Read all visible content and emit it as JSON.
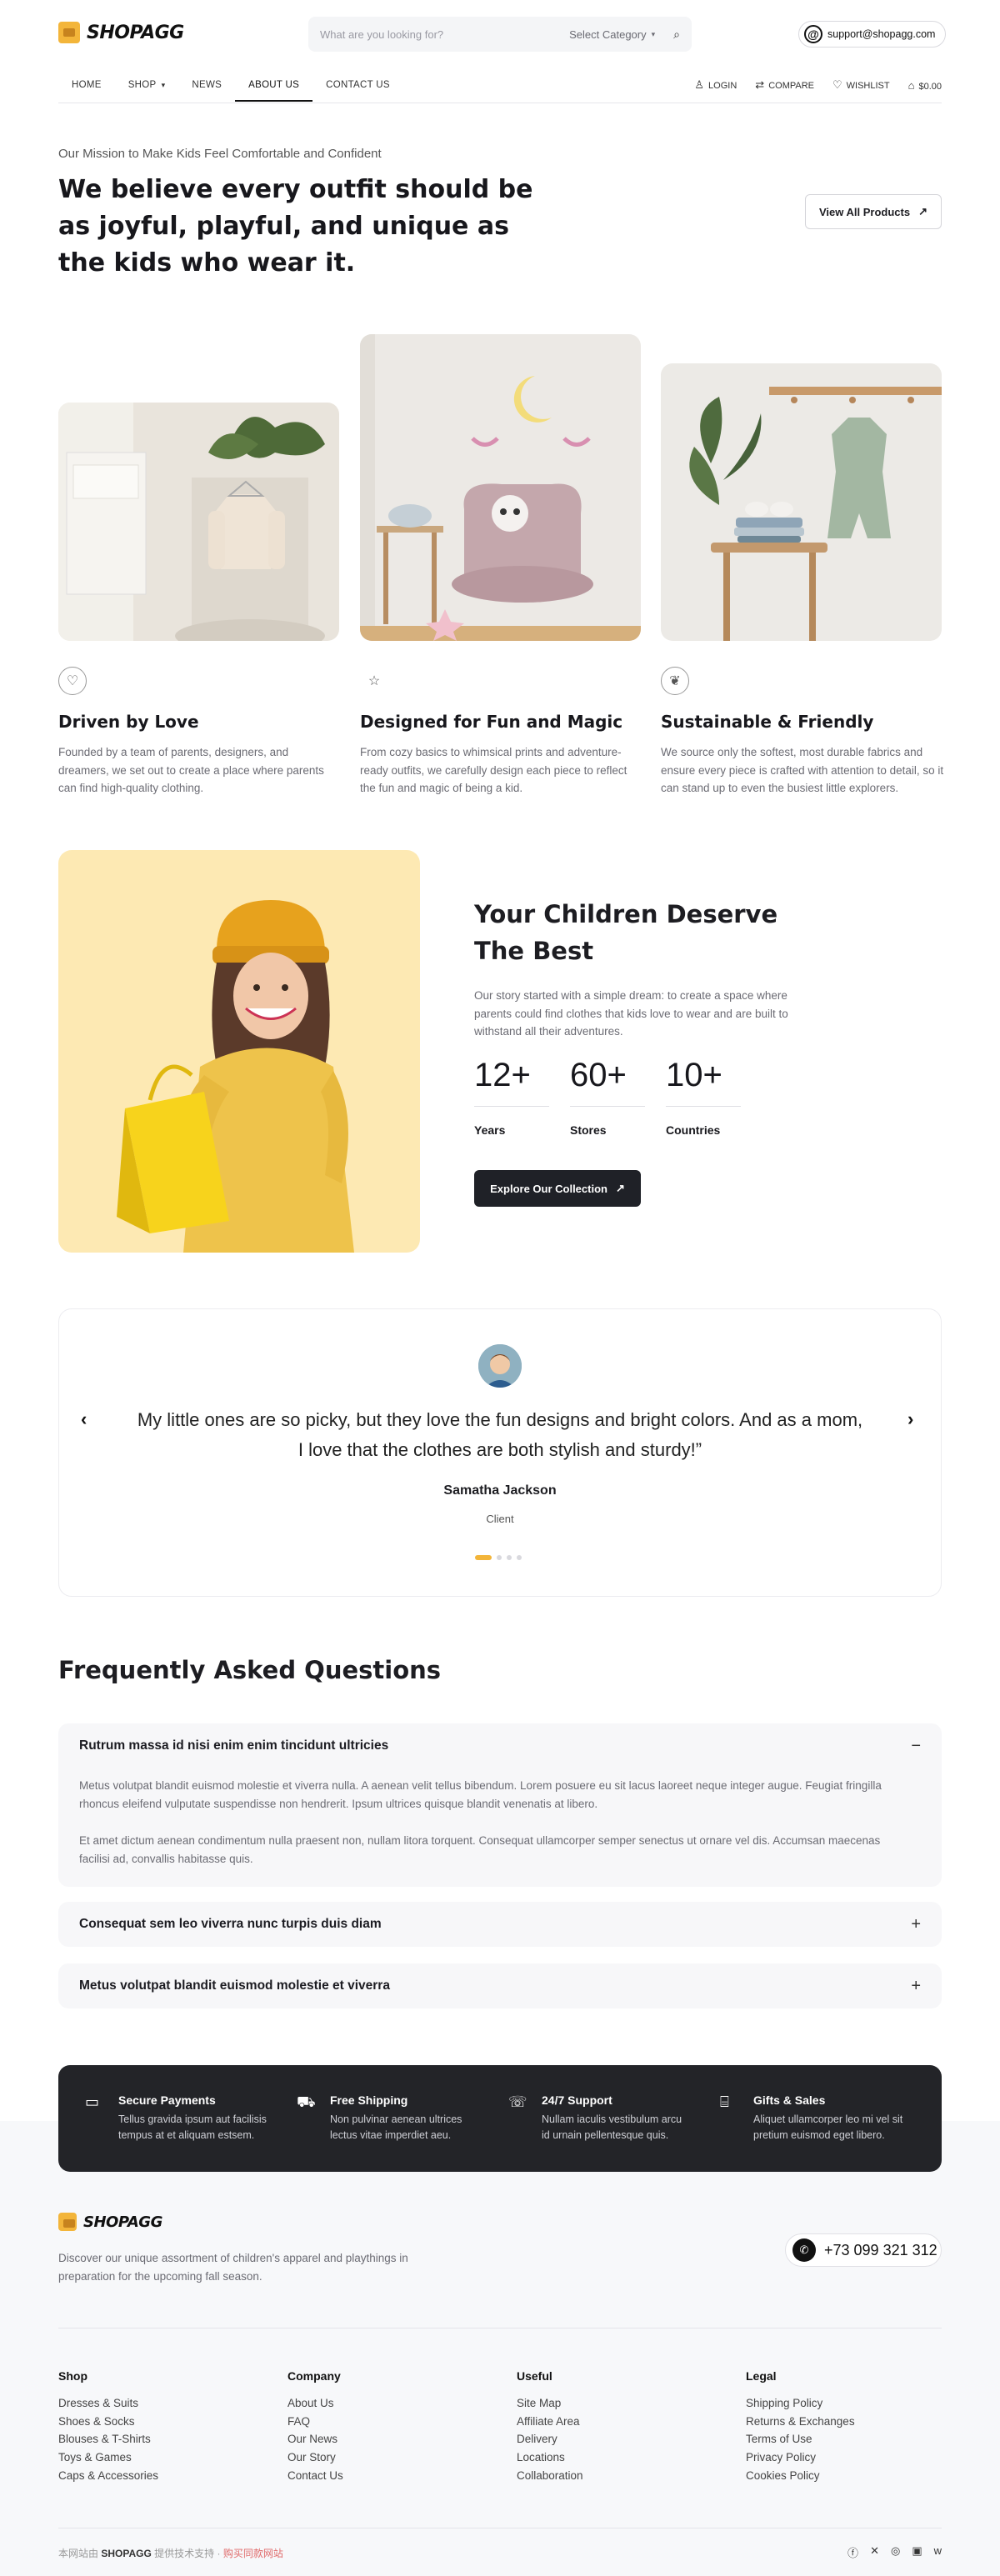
{
  "brand": {
    "name": "SHOPAGG",
    "logo": "shopagg-logo"
  },
  "header": {
    "search_placeholder": "What are you looking for?",
    "category_label": "Select Category",
    "support_email": "support@shopagg.com"
  },
  "nav": {
    "items": [
      "HOME",
      "SHOP",
      "NEWS",
      "ABOUT US",
      "CONTACT US"
    ],
    "active": "ABOUT US"
  },
  "utility": {
    "login": "LOGIN",
    "compare": "COMPARE",
    "wishlist": "WISHLIST",
    "cart": "$0.00"
  },
  "hero": {
    "eyebrow": "Our Mission to Make Kids Feel Comfortable and Confident",
    "headline": "We believe every outfit should be as joyful, playful, and unique as the kids who wear it.",
    "cta": "View All Products"
  },
  "features": [
    {
      "icon": "heart-hands-icon",
      "title": "Driven by Love",
      "text": "Founded by a team of parents, designers, and dreamers, we set out to create a place where parents can find high-quality clothing."
    },
    {
      "icon": "star-icon",
      "title": "Designed for Fun and Magic",
      "text": "From cozy basics to whimsical prints and adventure-ready outfits, we carefully design each piece to reflect the fun and magic of being a kid."
    },
    {
      "icon": "leaf-icon",
      "title": "Sustainable & Friendly",
      "text": "We source only the softest, most durable fabrics and ensure every piece is crafted with attention to detail, so it can stand up to even the busiest little explorers."
    }
  ],
  "about": {
    "title": "Your Children Deserve The Best",
    "text": "Our story started with a simple dream: to create a space where parents could find clothes that kids love to wear and are built to withstand all their adventures.",
    "stats": [
      {
        "num": "12+",
        "label": "Years"
      },
      {
        "num": "60+",
        "label": "Stores"
      },
      {
        "num": "10+",
        "label": "Countries"
      }
    ],
    "cta": "Explore Our Collection"
  },
  "testimonial": {
    "quote": "My little ones are so picky, but they love the fun designs and bright colors. And as a mom, I love that the clothes are both stylish and sturdy!”",
    "name": "Samatha Jackson",
    "role": "Client",
    "dots": 4,
    "active": 0
  },
  "faq": {
    "title": "Frequently Asked Questions",
    "items": [
      {
        "q": "Rutrum massa id nisi enim enim tincidunt ultricies",
        "open": true,
        "a1": "Metus volutpat blandit euismod molestie et viverra nulla. A aenean velit tellus bibendum. Lorem posuere eu sit lacus laoreet neque integer augue. Feugiat fringilla rhoncus eleifend vulputate suspendisse non hendrerit. Ipsum ultrices quisque blandit venenatis at libero.",
        "a2": "Et amet dictum aenean condimentum nulla praesent non, nullam litora torquent. Consequat ullamcorper semper senectus ut ornare vel dis. Accumsan maecenas facilisi ad, convallis habitasse quis."
      },
      {
        "q": "Consequat sem leo viverra nunc turpis duis diam",
        "open": false
      },
      {
        "q": "Metus volutpat blandit euismod molestie et viverra",
        "open": false
      }
    ]
  },
  "banner": [
    {
      "icon": "card-icon",
      "title": "Secure Payments",
      "text": "Tellus gravida ipsum aut facilisis tempus at et aliquam estsem."
    },
    {
      "icon": "truck-icon",
      "title": "Free Shipping",
      "text": "Non pulvinar aenean ultrices lectus vitae imperdiet aeu."
    },
    {
      "icon": "chat-icon",
      "title": "24/7 Support",
      "text": "Nullam iaculis vestibulum arcu id urnain pellentesque quis."
    },
    {
      "icon": "gift-icon",
      "title": "Gifts & Sales",
      "text": "Aliquet ullamcorper leo mi vel sit pretium euismod eget libero."
    }
  ],
  "footer": {
    "desc": "Discover our unique assortment of children's apparel and playthings in preparation for the upcoming fall season.",
    "phone": "+73 099 321 312",
    "columns": [
      {
        "title": "Shop",
        "links": [
          "Dresses & Suits",
          "Shoes & Socks",
          "Blouses & T-Shirts",
          "Toys & Games",
          "Caps & Accessories"
        ]
      },
      {
        "title": "Company",
        "links": [
          "About Us",
          "FAQ",
          "Our News",
          "Our Story",
          "Contact Us"
        ]
      },
      {
        "title": "Useful",
        "links": [
          "Site Map",
          "Affiliate Area",
          "Delivery",
          "Locations",
          "Collaboration"
        ]
      },
      {
        "title": "Legal",
        "links": [
          "Shipping Policy",
          "Returns & Exchanges",
          "Terms of Use",
          "Privacy Policy",
          "Cookies Policy"
        ]
      }
    ],
    "copy_prefix": "本网站由",
    "copy_brand": "SHOPAGG",
    "copy_mid": "提供技术支持 ·",
    "copy_link": "购买同款网站",
    "social": [
      "facebook-icon",
      "x-icon",
      "instagram-icon",
      "youtube-icon",
      "vk-icon"
    ]
  },
  "colors": {
    "accent": "#f3b53a",
    "dark": "#232428",
    "text": "#1d1d22",
    "muted": "#6b6b73"
  }
}
